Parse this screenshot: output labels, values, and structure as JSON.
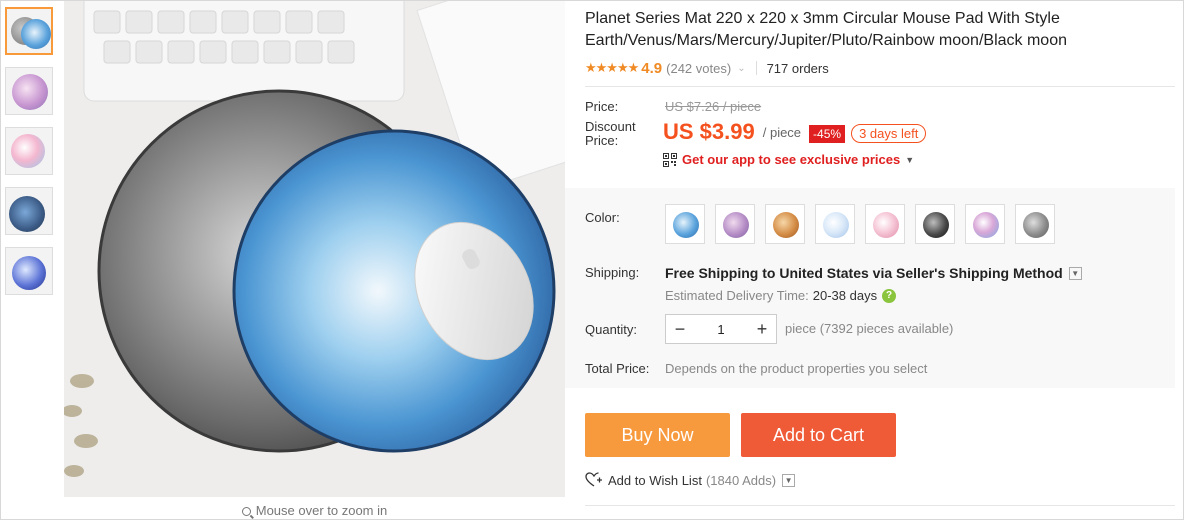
{
  "product": {
    "title": "Planet Series Mat 220 x 220 x 3mm Circular Mouse Pad With Style Earth/Venus/Mars/Mercury/Jupiter/Pluto/Rainbow moon/Black moon",
    "rating": "4.9",
    "votes": "(242 votes)",
    "orders": "717 orders",
    "stars": "★★★★★"
  },
  "price": {
    "price_label": "Price:",
    "original": "US $7.26 / piece",
    "discount_label": "Discount Price:",
    "current": "US $3.99",
    "unit": "/ piece",
    "discount_badge": "-45%",
    "time_left": "3 days left",
    "app_promo": "Get our app to see exclusive prices"
  },
  "options": {
    "color_label": "Color:",
    "swatches": [
      "earth",
      "venus",
      "mars",
      "mercury",
      "jupiter",
      "pluto",
      "rainbow moon",
      "black moon"
    ],
    "shipping_label": "Shipping:",
    "shipping_text": "Free Shipping to United States via Seller's Shipping Method",
    "delivery_label": "Estimated Delivery Time:",
    "delivery_days": "20-38 days",
    "quantity_label": "Quantity:",
    "quantity_value": "1",
    "quantity_avail": "piece (7392 pieces available)",
    "total_label": "Total Price:",
    "total_value": "Depends on the product properties you select"
  },
  "actions": {
    "buy_now": "Buy Now",
    "add_to_cart": "Add to Cart",
    "wish_list": "Add to Wish List",
    "wish_count": "(1840 Adds)"
  },
  "gallery": {
    "zoom_hint": "Mouse over to zoom in"
  },
  "colors": {
    "accent": "#f4511e",
    "buy": "#f79a3e",
    "cart": "#ef5a37"
  }
}
